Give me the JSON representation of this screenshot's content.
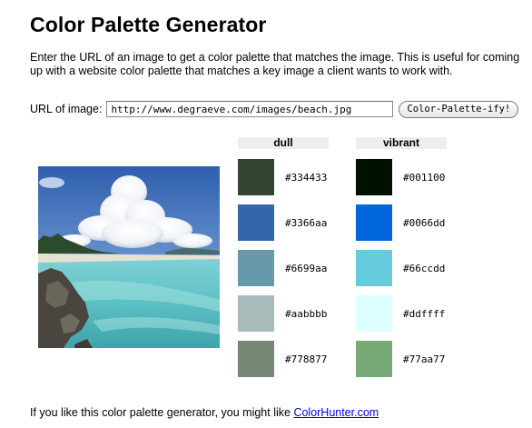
{
  "header": {
    "title": "Color Palette Generator",
    "intro": "Enter the URL of an image to get a color palette that matches the image. This is useful for coming up with a website color palette that matches a key image a client wants to work with."
  },
  "form": {
    "url_label": "URL of image:",
    "url_value": "http://www.degraeve.com/images/beach.jpg",
    "submit_label": "Color-Palette-ify!"
  },
  "image": {
    "alt": "beach"
  },
  "palette": {
    "dull": {
      "label": "dull",
      "colors": [
        "#334433",
        "#3366aa",
        "#6699aa",
        "#aabbbb",
        "#778877"
      ]
    },
    "vibrant": {
      "label": "vibrant",
      "colors": [
        "#001100",
        "#0066dd",
        "#66ccdd",
        "#ddffff",
        "#77aa77"
      ]
    }
  },
  "footer": {
    "text": "If you like this color palette generator, you might like ",
    "link_label": "ColorHunter.com"
  }
}
